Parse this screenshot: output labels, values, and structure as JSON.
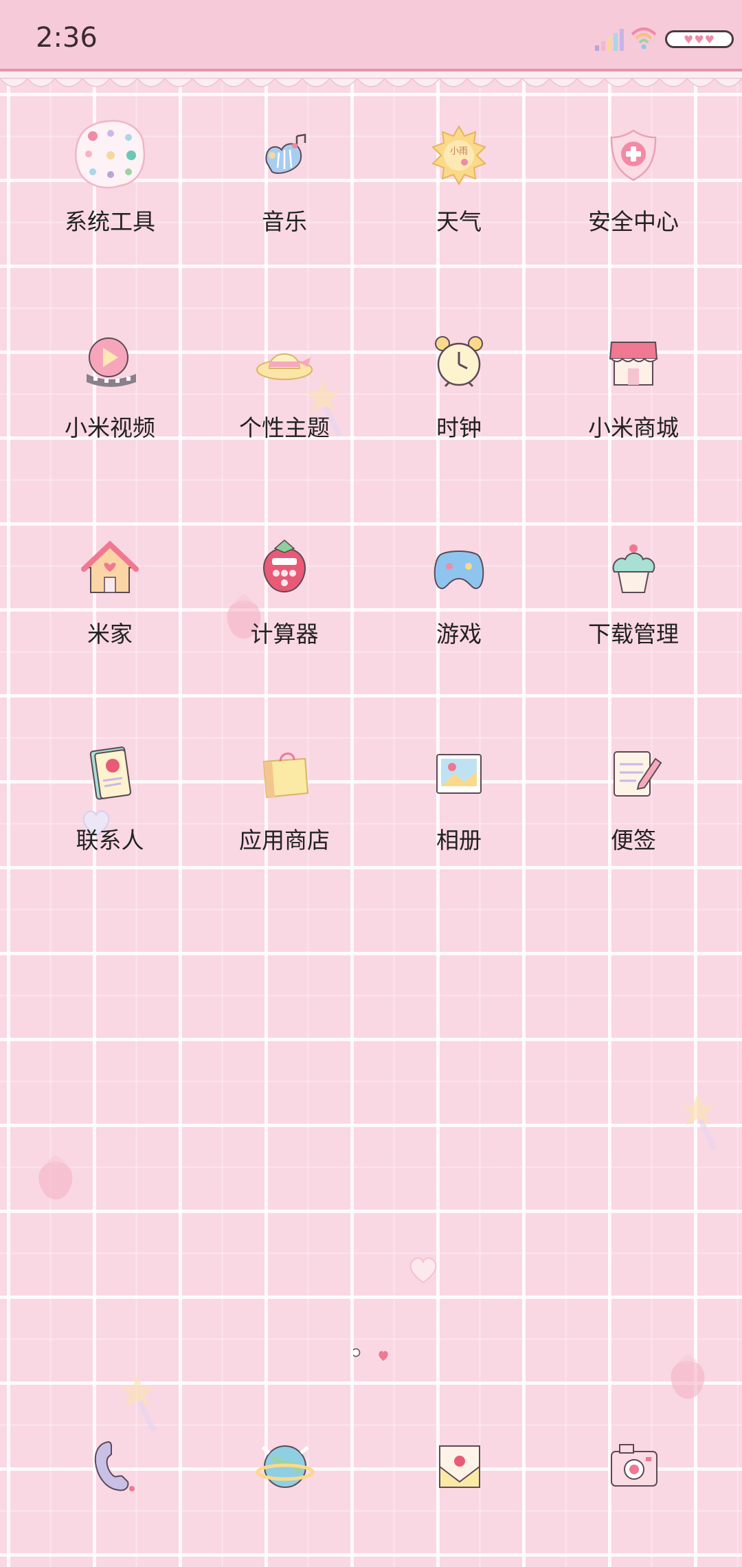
{
  "status_bar": {
    "time": "2:36"
  },
  "rows": [
    [
      {
        "label": "系统工具",
        "icon": "folder-icon"
      },
      {
        "label": "音乐",
        "icon": "harp-music-icon"
      },
      {
        "label": "天气",
        "icon": "sun-weather-icon",
        "icon_text": "小雨"
      },
      {
        "label": "安全中心",
        "icon": "shield-icon"
      }
    ],
    [
      {
        "label": "小米视频",
        "icon": "video-play-icon"
      },
      {
        "label": "个性主题",
        "icon": "sun-hat-icon"
      },
      {
        "label": "时钟",
        "icon": "alarm-clock-icon"
      },
      {
        "label": "小米商城",
        "icon": "shop-icon"
      }
    ],
    [
      {
        "label": "米家",
        "icon": "house-icon"
      },
      {
        "label": "计算器",
        "icon": "strawberry-calculator-icon"
      },
      {
        "label": "游戏",
        "icon": "gamepad-icon"
      },
      {
        "label": "下载管理",
        "icon": "cupcake-icon"
      }
    ],
    [
      {
        "label": "联系人",
        "icon": "notebook-icon"
      },
      {
        "label": "应用商店",
        "icon": "shopping-bag-icon"
      },
      {
        "label": "相册",
        "icon": "photo-icon"
      },
      {
        "label": "便签",
        "icon": "note-pencil-icon"
      }
    ]
  ],
  "dock": [
    {
      "icon": "phone-icon"
    },
    {
      "icon": "globe-browser-icon"
    },
    {
      "icon": "envelope-message-icon"
    },
    {
      "icon": "camera-icon"
    }
  ],
  "page_indicator": {
    "pages": 2,
    "current": 2
  },
  "colors": {
    "background": "#f9d7e3",
    "accent": "#e893a9",
    "grid": "#ffffff"
  }
}
